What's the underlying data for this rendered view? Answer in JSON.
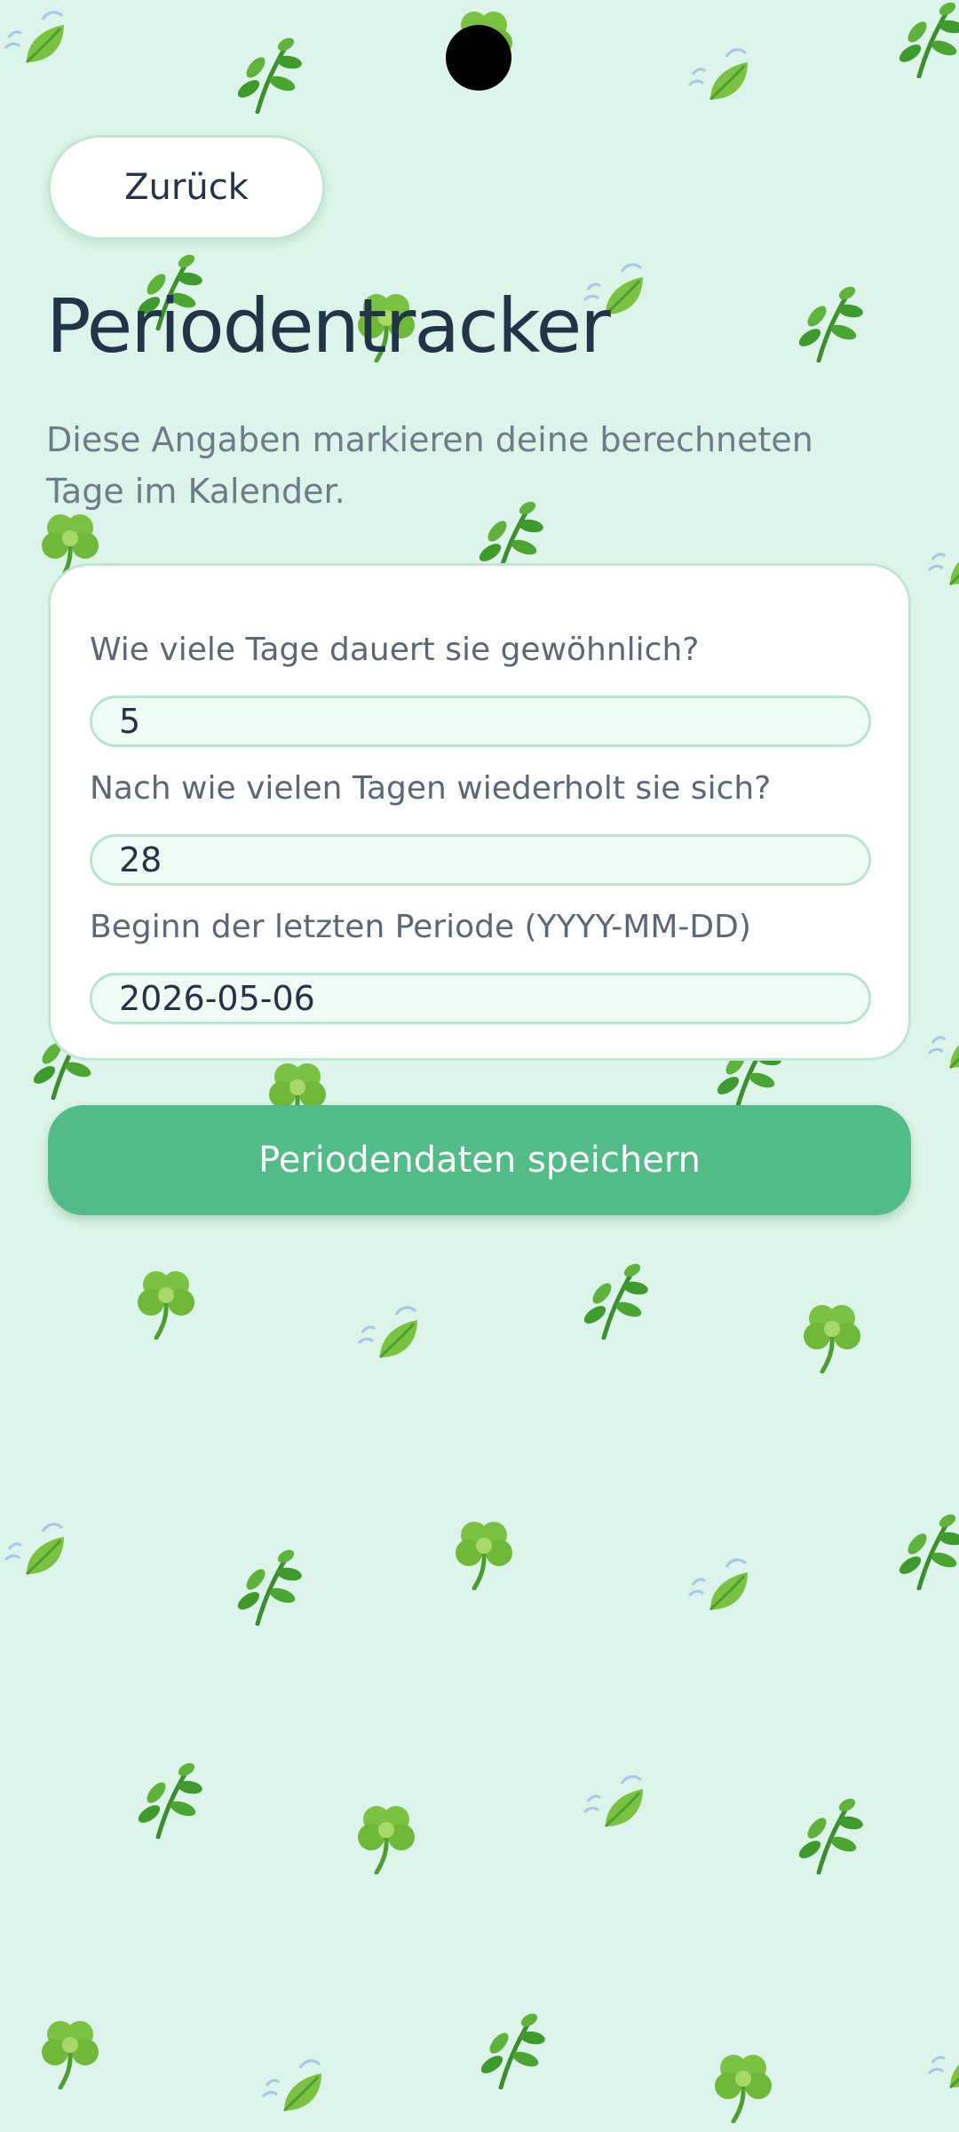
{
  "header": {
    "back_label": "Zurück"
  },
  "page": {
    "title": "Periodentracker",
    "subtitle": "Diese Angaben markieren deine berechneten Tage im Kalender."
  },
  "form": {
    "duration": {
      "label": "Wie viele Tage dauert sie gewöhnlich?",
      "value": "5"
    },
    "cycle": {
      "label": "Nach wie vielen Tagen wiederholt sie sich?",
      "value": "28"
    },
    "last_start": {
      "label": "Beginn der letzten Periode (YYYY-MM-DD)",
      "value": "2026-05-06"
    }
  },
  "actions": {
    "save_label": "Periodendaten speichern"
  },
  "decorations": {
    "icons": [
      "herb-icon",
      "shamrock-icon",
      "leaf-wind-icon"
    ],
    "colors": {
      "background": "#dcf4e9",
      "accent": "#52bb87",
      "leaf_dark": "#3f9a2e",
      "leaf_light": "#7cc242"
    }
  }
}
